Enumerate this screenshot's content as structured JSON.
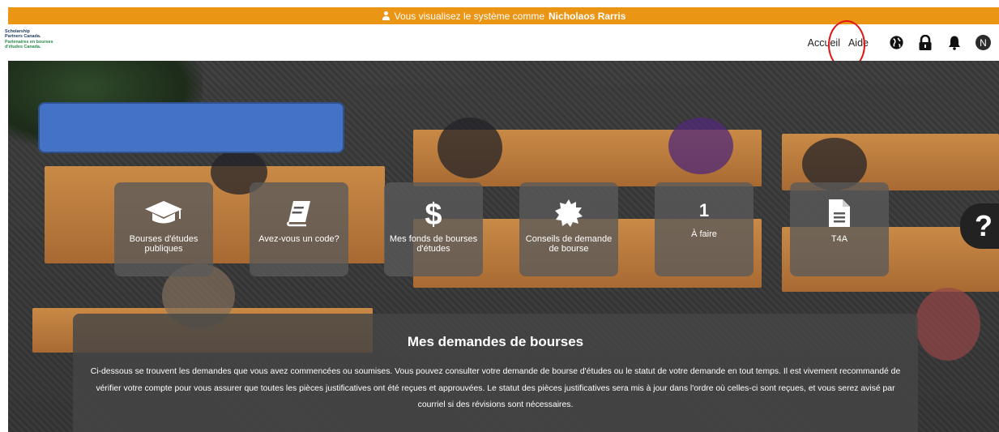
{
  "impersonation": {
    "prefix": "Vous visualisez le système comme",
    "user_name": "Nicholaos Rarris",
    "icon": "user-icon"
  },
  "logo": {
    "lines": [
      "Scholarship",
      "Partners Canada.",
      "Partenaires en bourses",
      "d'études Canada."
    ]
  },
  "nav": {
    "home": "Accueil",
    "help": "Aide",
    "language_icon": "globe-icon",
    "lock_icon": "lock-icon",
    "notifications_icon": "bell-icon",
    "avatar_initial": "N"
  },
  "tiles": [
    {
      "icon": "graduation-cap-icon",
      "label": "Bourses d'études publiques"
    },
    {
      "icon": "book-icon",
      "label": "Avez-vous un code?"
    },
    {
      "icon": "dollar-icon",
      "label": "Mes fonds de bourses d'études"
    },
    {
      "icon": "badge-icon",
      "label": "Conseils de demande de bourse"
    },
    {
      "number": "1",
      "label": "À faire"
    },
    {
      "icon": "document-icon",
      "label": "T4A"
    }
  ],
  "help_button": "?",
  "applications": {
    "title": "Mes demandes de bourses",
    "description": "Ci-dessous se trouvent les demandes que vous avez commencées ou soumises. Vous pouvez consulter votre demande de bourse d'études ou le statut de votre demande en tout temps. Il est vivement recommandé de vérifier votre compte pour vous assurer que toutes les pièces justificatives ont été reçues et approuvées. Le statut des pièces justificatives sera mis à jour dans l'ordre où celles-ci sont reçues, et vous serez avisé par courriel si des révisions sont nécessaires."
  },
  "colors": {
    "impersonation_bar": "#eb9515",
    "title_placeholder": "#4472c4",
    "highlight_ring": "#e01414"
  }
}
